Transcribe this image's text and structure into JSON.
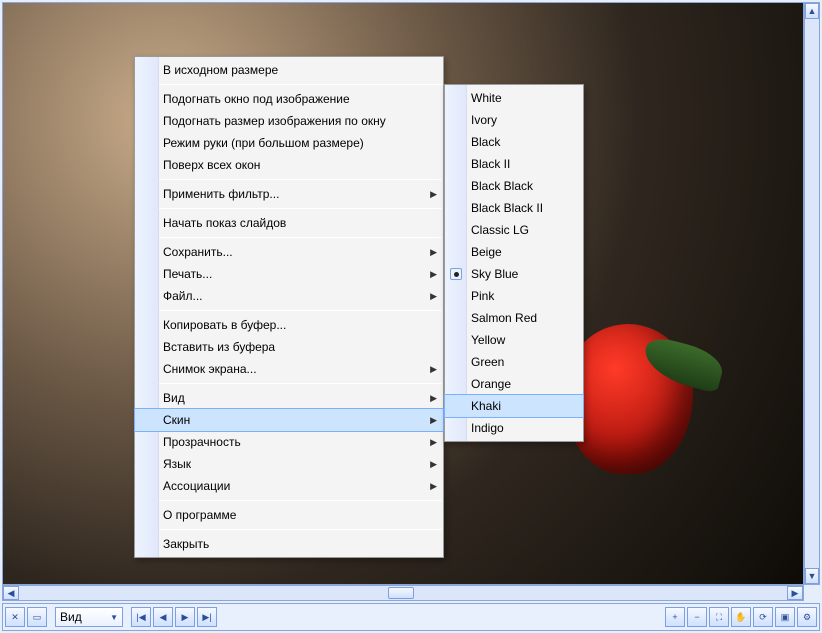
{
  "toolbar": {
    "mode_label": "Вид",
    "btn_close": "✕",
    "btn_minimize": "▭",
    "btn_prevset": "|◀",
    "btn_prev": "◀",
    "btn_next": "▶",
    "btn_nextset": "▶|",
    "btn_zoom_in": "+",
    "btn_zoom_out": "−",
    "btn_fit": "⛶",
    "btn_hand": "✋",
    "btn_rotate": "⟳",
    "btn_fullscreen": "▣",
    "btn_settings": "⚙"
  },
  "scrollbar": {
    "up": "▲",
    "down": "▼",
    "left": "◀",
    "right": "▶"
  },
  "context_menu": [
    {
      "label": "В исходном размере"
    },
    {
      "sep": true
    },
    {
      "label": "Подогнать окно под изображение"
    },
    {
      "label": "Подогнать размер изображения по окну"
    },
    {
      "label": "Режим руки (при большом размере)"
    },
    {
      "label": "Поверх всех окон"
    },
    {
      "sep": true
    },
    {
      "label": "Применить фильтр...",
      "submenu": true
    },
    {
      "sep": true
    },
    {
      "label": "Начать показ слайдов"
    },
    {
      "sep": true
    },
    {
      "label": "Сохранить...",
      "submenu": true
    },
    {
      "label": "Печать...",
      "submenu": true
    },
    {
      "label": "Файл...",
      "submenu": true
    },
    {
      "sep": true
    },
    {
      "label": "Копировать в буфер..."
    },
    {
      "label": "Вставить из буфера"
    },
    {
      "label": "Снимок экрана...",
      "submenu": true
    },
    {
      "sep": true
    },
    {
      "label": "Вид",
      "submenu": true
    },
    {
      "label": "Скин",
      "submenu": true,
      "hover": true
    },
    {
      "label": "Прозрачность",
      "submenu": true
    },
    {
      "label": "Язык",
      "submenu": true
    },
    {
      "label": "Ассоциации",
      "submenu": true
    },
    {
      "sep": true
    },
    {
      "label": "О программе"
    },
    {
      "sep": true
    },
    {
      "label": "Закрыть"
    }
  ],
  "skin_submenu": [
    {
      "label": "White"
    },
    {
      "label": "Ivory"
    },
    {
      "label": "Black"
    },
    {
      "label": "Black II"
    },
    {
      "label": "Black Black"
    },
    {
      "label": "Black Black II"
    },
    {
      "label": "Classic LG"
    },
    {
      "label": "Beige"
    },
    {
      "label": "Sky Blue",
      "selected": true
    },
    {
      "label": "Pink"
    },
    {
      "label": "Salmon Red"
    },
    {
      "label": "Yellow"
    },
    {
      "label": "Green"
    },
    {
      "label": "Orange"
    },
    {
      "label": "Khaki",
      "hover": true
    },
    {
      "label": "Indigo"
    }
  ]
}
